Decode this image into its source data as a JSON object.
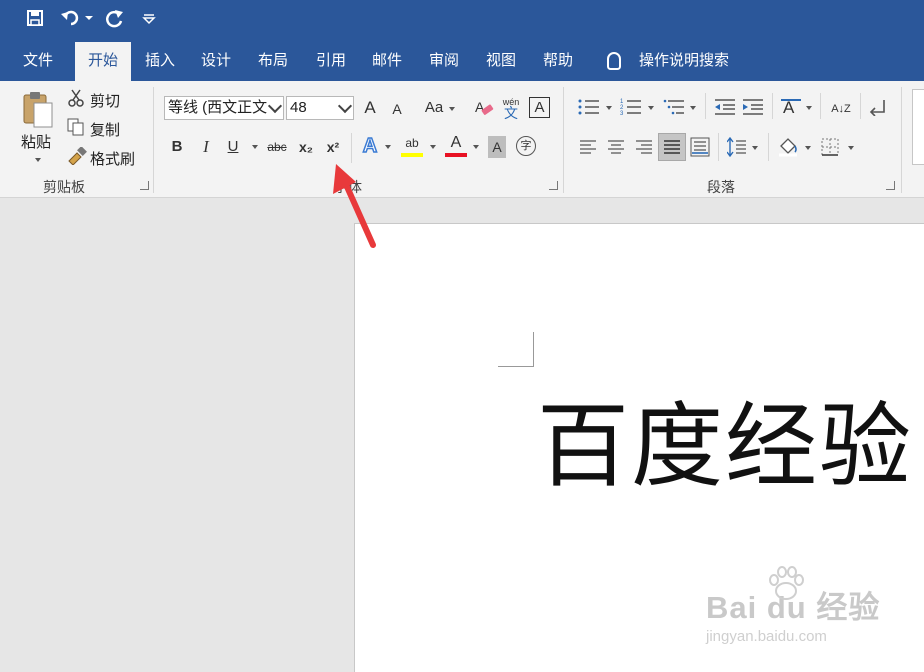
{
  "quick_access": {
    "save_icon": "save-icon",
    "undo_icon": "undo-icon",
    "redo_icon": "redo-icon",
    "customize_icon": "customize-qat-icon"
  },
  "tabs": [
    {
      "label": "文件"
    },
    {
      "label": "开始",
      "active": true
    },
    {
      "label": "插入"
    },
    {
      "label": "设计"
    },
    {
      "label": "布局"
    },
    {
      "label": "引用"
    },
    {
      "label": "邮件"
    },
    {
      "label": "审阅"
    },
    {
      "label": "视图"
    },
    {
      "label": "帮助"
    }
  ],
  "tell_me": {
    "label": "操作说明搜索"
  },
  "clipboard": {
    "paste_label": "粘贴",
    "cut_label": "剪切",
    "copy_label": "复制",
    "format_painter_label": "格式刷",
    "group_label": "剪贴板"
  },
  "font": {
    "font_name": "等线 (西文正文",
    "font_size": "48",
    "bold": "B",
    "italic": "I",
    "underline": "U",
    "strikethrough": "abc",
    "subscript": "x₂",
    "superscript": "x²",
    "change_case": "Aa",
    "grow": "A",
    "shrink": "A",
    "phonetic": "wén",
    "phonetic_char": "文",
    "border_char": "A",
    "effects": "A",
    "highlight": "ab",
    "font_color": "A",
    "shading": "A",
    "enclose": "字",
    "group_label": "字体",
    "highlight_color": "#ffff00",
    "font_color_value": "#e81123"
  },
  "paragraph": {
    "group_label": "段落",
    "sort_label": "A↓Z"
  },
  "document": {
    "body_text": "百度经验"
  },
  "watermark": {
    "brand": "Bai du 经验",
    "url": "jingyan.baidu.com"
  },
  "colors": {
    "accent": "#2b579a",
    "ribbon_bg": "#f3f3f3",
    "workspace_bg": "#e6e6e6",
    "arrow": "#e8393b"
  }
}
